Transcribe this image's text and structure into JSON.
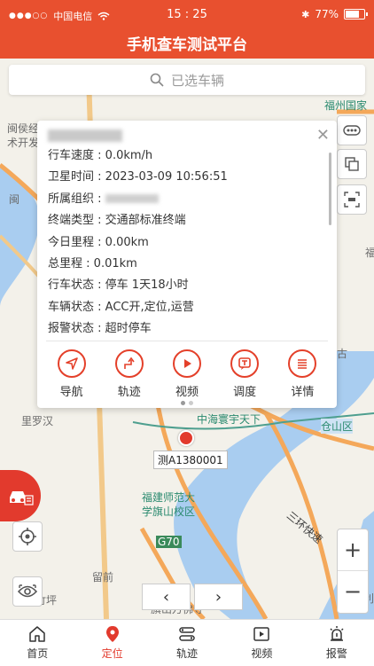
{
  "status_bar": {
    "carrier": "中国电信",
    "time": "15 : 25",
    "battery": "77%"
  },
  "header": {
    "title": "手机查车测试平台"
  },
  "search": {
    "placeholder": "已选车辆"
  },
  "popup": {
    "rows": [
      {
        "label": "行车速度",
        "value": "0.0km/h"
      },
      {
        "label": "卫星时间",
        "value": "2023-03-09 10:56:51"
      },
      {
        "label": "所属组织",
        "value": ""
      },
      {
        "label": "终端类型",
        "value": "交通部标准终端"
      },
      {
        "label": "今日里程",
        "value": "0.00km"
      },
      {
        "label": "总里程",
        "value": "0.01km"
      },
      {
        "label": "行车状态",
        "value": "停车 1天18小时"
      },
      {
        "label": "车辆状态",
        "value": "ACC开,定位,运营"
      },
      {
        "label": "报警状态",
        "value": "超时停车"
      }
    ],
    "actions": [
      {
        "label": "导航",
        "icon": "navigation-icon"
      },
      {
        "label": "轨迹",
        "icon": "track-icon"
      },
      {
        "label": "视频",
        "icon": "video-icon"
      },
      {
        "label": "调度",
        "icon": "dispatch-icon"
      },
      {
        "label": "详情",
        "icon": "details-icon"
      }
    ]
  },
  "map": {
    "vehicle_label": "测A1380001",
    "labels": [
      "福州国家",
      "闽侯经",
      "术开发",
      "闽",
      "里罗汉",
      "中海寰宇天下",
      "仓山区",
      "福建师范大",
      "学旗山校区",
      "G70",
      "留前",
      "旗山万佛寺",
      "竹坪",
      "三环快速",
      "福",
      "古",
      "利"
    ]
  },
  "tabs": [
    {
      "label": "首页",
      "icon": "home-icon"
    },
    {
      "label": "定位",
      "icon": "location-icon",
      "active": true
    },
    {
      "label": "轨迹",
      "icon": "track-icon"
    },
    {
      "label": "视频",
      "icon": "video-icon"
    },
    {
      "label": "报警",
      "icon": "alarm-icon"
    }
  ],
  "colors": {
    "brand": "#e8502f",
    "accent": "#e23a2d",
    "water": "#a9cdf0"
  }
}
